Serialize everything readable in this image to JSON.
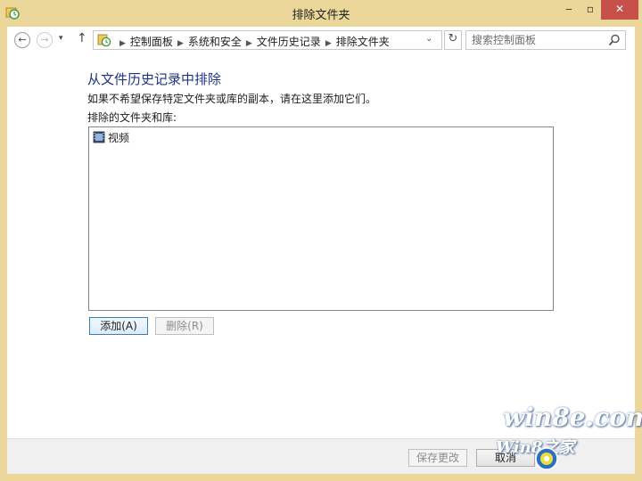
{
  "window": {
    "title": "排除文件夹",
    "controls": {
      "minimize": "‒",
      "maximize": "▫",
      "close": "✕"
    }
  },
  "navigation": {
    "back": "←",
    "forward": "→",
    "recent": "▾",
    "up": "↑",
    "breadcrumbs": [
      "控制面板",
      "系统和安全",
      "文件历史记录",
      "排除文件夹"
    ],
    "breadcrumb_separator": "▶",
    "address_dropdown": "⌄",
    "refresh": "↻",
    "search_placeholder": "搜索控制面板"
  },
  "content": {
    "heading": "从文件历史记录中排除",
    "description": "如果不希望保存特定文件夹或库的副本，请在这里添加它们。",
    "list_label": "排除的文件夹和库:",
    "excluded_items": [
      {
        "name": "视频",
        "icon": "video-library-icon"
      }
    ],
    "add_button": "添加(A)",
    "remove_button": "删除(R)"
  },
  "footer": {
    "save_button": "保存更改",
    "cancel_button": "取消"
  },
  "watermark": {
    "line1": "win8e.com",
    "line2": "Win8之家"
  },
  "colors": {
    "title_bar": "#ecd79a",
    "heading": "#1e3287",
    "close_button": "#c7504a",
    "primary_button_border": "#3c7fb1"
  }
}
